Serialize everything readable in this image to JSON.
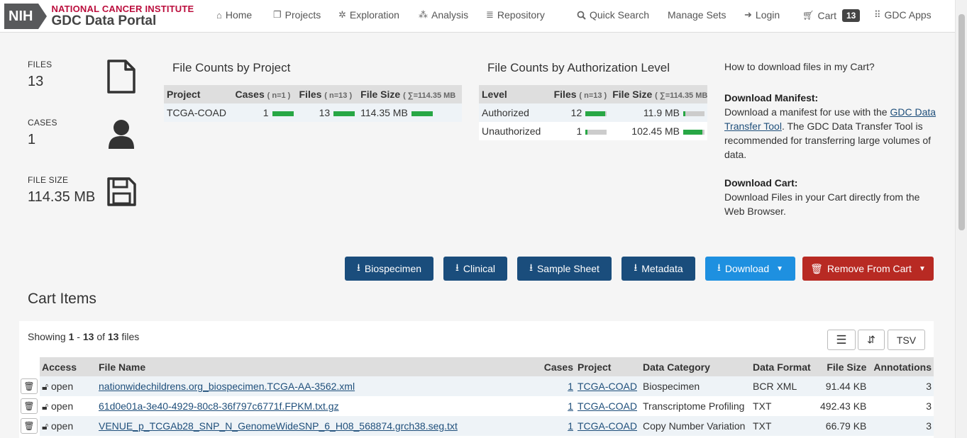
{
  "header": {
    "logo_nih": "NIH",
    "logo_nci": "NATIONAL CANCER INSTITUTE",
    "logo_gdc": "GDC Data Portal",
    "nav": [
      {
        "label": "Home",
        "icon": "home-icon"
      },
      {
        "label": "Projects",
        "icon": "projects-icon"
      },
      {
        "label": "Exploration",
        "icon": "exploration-icon"
      },
      {
        "label": "Analysis",
        "icon": "analysis-icon"
      },
      {
        "label": "Repository",
        "icon": "repository-icon"
      },
      {
        "label": "Quick Search",
        "icon": "search-icon"
      },
      {
        "label": "Manage Sets",
        "icon": ""
      },
      {
        "label": "Login",
        "icon": "login-icon"
      },
      {
        "label": "Cart",
        "icon": "cart-icon"
      },
      {
        "label": "GDC Apps",
        "icon": "apps-grid-icon"
      }
    ],
    "cart_count": "13"
  },
  "summary": {
    "files_label": "FILES",
    "files_value": "13",
    "cases_label": "CASES",
    "cases_value": "1",
    "size_label": "FILE SIZE",
    "size_value": "114.35 MB"
  },
  "by_project": {
    "title": "File Counts by Project",
    "headers": {
      "project": "Project",
      "cases": "Cases",
      "cases_n": "( n=1 )",
      "files": "Files",
      "files_n": "( n=13 )",
      "size": "File Size",
      "size_n": "( ∑=114.35 MB"
    },
    "rows": [
      {
        "project": "TCGA-COAD",
        "cases": "1",
        "cases_frac": 1.0,
        "files": "13",
        "files_frac": 1.0,
        "size": "114.35 MB",
        "size_frac": 1.0
      }
    ]
  },
  "by_auth": {
    "title": "File Counts by Authorization Level",
    "headers": {
      "level": "Level",
      "files": "Files",
      "files_n": "( n=13 )",
      "size": "File Size",
      "size_n": "( ∑=114.35 MB"
    },
    "rows": [
      {
        "level": "Authorized",
        "files": "12",
        "files_frac": 0.92,
        "size": "11.9 MB",
        "size_frac": 0.1
      },
      {
        "level": "Unauthorized",
        "files": "1",
        "files_frac": 0.08,
        "size": "102.45 MB",
        "size_frac": 0.9
      }
    ]
  },
  "help": {
    "question": "How to download files in my Cart?",
    "manifest_title": "Download Manifest:",
    "manifest_text_1": "Download a manifest for use with the ",
    "manifest_link": "GDC Data Transfer Tool",
    "manifest_text_2": ". The GDC Data Transfer Tool is recommended for transferring large volumes of data.",
    "cart_title": "Download Cart:",
    "cart_text": "Download Files in your Cart directly from the Web Browser."
  },
  "actions": {
    "biospecimen": "Biospecimen",
    "clinical": "Clinical",
    "sample_sheet": "Sample Sheet",
    "metadata": "Metadata",
    "download": "Download",
    "remove": "Remove From Cart"
  },
  "colors": {
    "navy": "#1a4d7c",
    "blue": "#1e90e0",
    "red": "#b82a23",
    "green": "#28a745"
  },
  "cart_items": {
    "title": "Cart Items",
    "showing_word": "Showing",
    "range_start": "1",
    "range_sep": "-",
    "range_end": "13",
    "of_word": "of",
    "total": "13",
    "files_word": "files",
    "tsv": "TSV",
    "headers": {
      "access": "Access",
      "file_name": "File Name",
      "cases": "Cases",
      "project": "Project",
      "category": "Data Category",
      "format": "Data Format",
      "size": "File Size",
      "annotations": "Annotations"
    },
    "rows": [
      {
        "access": "open",
        "file_name": "nationwidechildrens.org_biospecimen.TCGA-AA-3562.xml",
        "cases": "1",
        "project": "TCGA-COAD",
        "category": "Biospecimen",
        "format": "BCR XML",
        "size": "91.44 KB",
        "annotations": "3"
      },
      {
        "access": "open",
        "file_name": "61d0e01a-3e40-4929-80c8-36f797c6771f.FPKM.txt.gz",
        "cases": "1",
        "project": "TCGA-COAD",
        "category": "Transcriptome Profiling",
        "format": "TXT",
        "size": "492.43 KB",
        "annotations": "3"
      },
      {
        "access": "open",
        "file_name": "VENUE_p_TCGAb28_SNP_N_GenomeWideSNP_6_H08_568874.grch38.seg.txt",
        "cases": "1",
        "project": "TCGA-COAD",
        "category": "Copy Number Variation",
        "format": "TXT",
        "size": "66.79 KB",
        "annotations": "3"
      }
    ]
  }
}
